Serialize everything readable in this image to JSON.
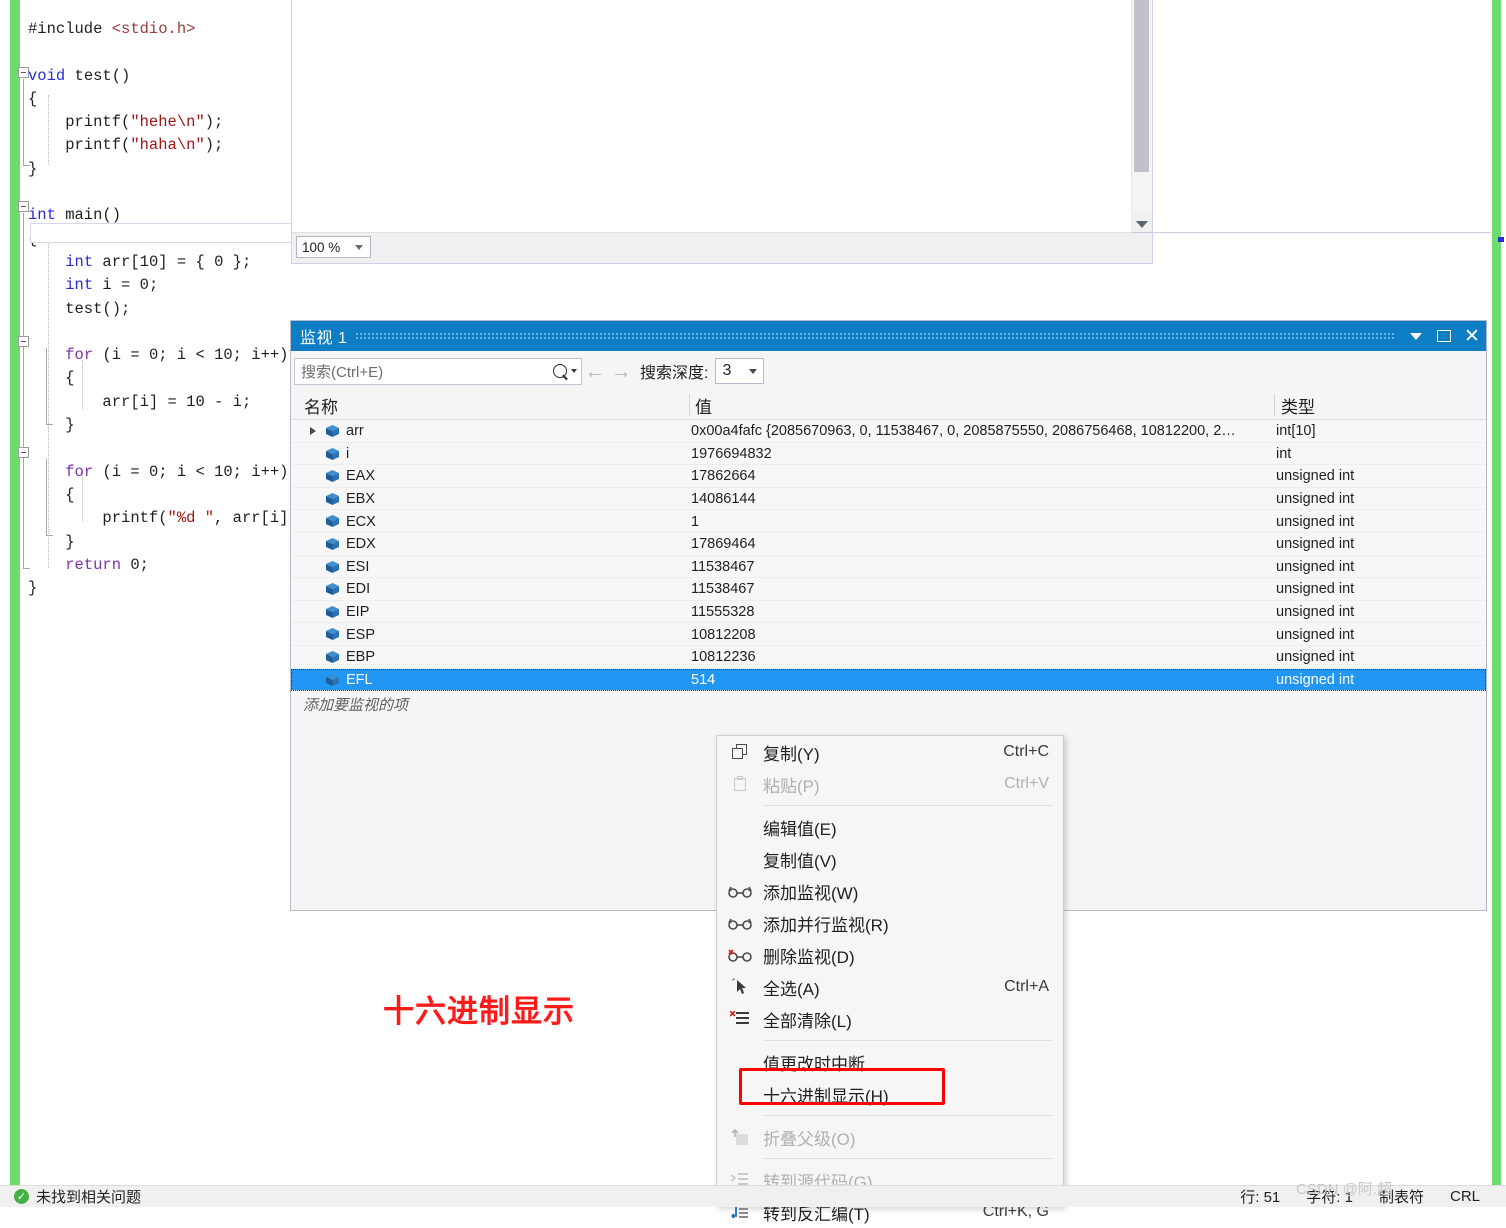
{
  "editor": {
    "zoom_value": "100 %",
    "code_lines": [
      [
        {
          "t": "#include ",
          "c": "plain"
        },
        {
          "t": "<stdio.h>",
          "c": "pre"
        }
      ],
      [],
      [
        {
          "t": "void",
          "c": "kw"
        },
        {
          "t": " test()",
          "c": "plain"
        }
      ],
      [
        {
          "t": "{",
          "c": "plain"
        }
      ],
      [
        {
          "t": "    printf(",
          "c": "plain"
        },
        {
          "t": "\"hehe\\n\"",
          "c": "str"
        },
        {
          "t": ");",
          "c": "plain"
        }
      ],
      [
        {
          "t": "    printf(",
          "c": "plain"
        },
        {
          "t": "\"haha\\n\"",
          "c": "str"
        },
        {
          "t": ");",
          "c": "plain"
        }
      ],
      [
        {
          "t": "}",
          "c": "plain"
        }
      ],
      [],
      [
        {
          "t": "int",
          "c": "kw"
        },
        {
          "t": " main()",
          "c": "plain"
        }
      ],
      [
        {
          "t": "{",
          "c": "plain"
        }
      ],
      [
        {
          "t": "    ",
          "c": "plain"
        },
        {
          "t": "int",
          "c": "kw"
        },
        {
          "t": " arr[",
          "c": "plain"
        },
        {
          "t": "10",
          "c": "num"
        },
        {
          "t": "] = { ",
          "c": "plain"
        },
        {
          "t": "0",
          "c": "num"
        },
        {
          "t": " };",
          "c": "plain"
        }
      ],
      [
        {
          "t": "    ",
          "c": "plain"
        },
        {
          "t": "int",
          "c": "kw"
        },
        {
          "t": " i = ",
          "c": "plain"
        },
        {
          "t": "0",
          "c": "num"
        },
        {
          "t": ";",
          "c": "plain"
        }
      ],
      [
        {
          "t": "    test();",
          "c": "plain"
        }
      ],
      [],
      [
        {
          "t": "    ",
          "c": "plain"
        },
        {
          "t": "for",
          "c": "ctl"
        },
        {
          "t": " (i = ",
          "c": "plain"
        },
        {
          "t": "0",
          "c": "num"
        },
        {
          "t": "; i < ",
          "c": "plain"
        },
        {
          "t": "10",
          "c": "num"
        },
        {
          "t": "; i++)",
          "c": "plain"
        }
      ],
      [
        {
          "t": "    {",
          "c": "plain"
        }
      ],
      [
        {
          "t": "        arr[i] = ",
          "c": "plain"
        },
        {
          "t": "10",
          "c": "num"
        },
        {
          "t": " - i;",
          "c": "plain"
        }
      ],
      [
        {
          "t": "    }",
          "c": "plain"
        }
      ],
      [],
      [
        {
          "t": "    ",
          "c": "plain"
        },
        {
          "t": "for",
          "c": "ctl"
        },
        {
          "t": " (i = ",
          "c": "plain"
        },
        {
          "t": "0",
          "c": "num"
        },
        {
          "t": "; i < ",
          "c": "plain"
        },
        {
          "t": "10",
          "c": "num"
        },
        {
          "t": "; i++)",
          "c": "plain"
        }
      ],
      [
        {
          "t": "    {",
          "c": "plain"
        }
      ],
      [
        {
          "t": "        printf(",
          "c": "plain"
        },
        {
          "t": "\"%d \"",
          "c": "str"
        },
        {
          "t": ", arr[i]);",
          "c": "plain"
        }
      ],
      [
        {
          "t": "    }",
          "c": "plain"
        }
      ],
      [
        {
          "t": "    ",
          "c": "plain"
        },
        {
          "t": "return",
          "c": "ctl"
        },
        {
          "t": " ",
          "c": "plain"
        },
        {
          "t": "0",
          "c": "num"
        },
        {
          "t": ";",
          "c": "plain"
        }
      ],
      [
        {
          "t": "}",
          "c": "plain"
        }
      ]
    ]
  },
  "watch": {
    "title": "监视 1",
    "search_placeholder": "搜索(Ctrl+E)",
    "depth_label": "搜索深度:",
    "depth_value": "3",
    "columns": [
      "名称",
      "值",
      "类型"
    ],
    "rows": [
      {
        "name": "arr",
        "value": "0x00a4fafc {2085670963, 0, 11538467, 0, 2085875550, 2086756468, 10812200, 2…",
        "type": "int[10]",
        "expandable": true,
        "selected": false
      },
      {
        "name": "i",
        "value": "1976694832",
        "type": "int",
        "expandable": false,
        "selected": false
      },
      {
        "name": "EAX",
        "value": "17862664",
        "type": "unsigned int",
        "expandable": false,
        "selected": false
      },
      {
        "name": "EBX",
        "value": "14086144",
        "type": "unsigned int",
        "expandable": false,
        "selected": false
      },
      {
        "name": "ECX",
        "value": "1",
        "type": "unsigned int",
        "expandable": false,
        "selected": false
      },
      {
        "name": "EDX",
        "value": "17869464",
        "type": "unsigned int",
        "expandable": false,
        "selected": false
      },
      {
        "name": "ESI",
        "value": "11538467",
        "type": "unsigned int",
        "expandable": false,
        "selected": false
      },
      {
        "name": "EDI",
        "value": "11538467",
        "type": "unsigned int",
        "expandable": false,
        "selected": false
      },
      {
        "name": "EIP",
        "value": "11555328",
        "type": "unsigned int",
        "expandable": false,
        "selected": false
      },
      {
        "name": "ESP",
        "value": "10812208",
        "type": "unsigned int",
        "expandable": false,
        "selected": false
      },
      {
        "name": "EBP",
        "value": "10812236",
        "type": "unsigned int",
        "expandable": false,
        "selected": false
      },
      {
        "name": "EFL",
        "value": "514",
        "type": "unsigned int",
        "expandable": false,
        "selected": true
      }
    ],
    "add_item_hint": "添加要监视的项"
  },
  "annotation": {
    "red_text": "十六进制显示"
  },
  "context_menu": {
    "items": [
      {
        "label": "复制(Y)",
        "shortcut": "Ctrl+C",
        "icon": "copy-icon",
        "disabled": false
      },
      {
        "label": "粘贴(P)",
        "shortcut": "Ctrl+V",
        "icon": "paste-icon",
        "disabled": true
      },
      {
        "separator": true
      },
      {
        "label": "编辑值(E)",
        "shortcut": "",
        "icon": "",
        "disabled": false
      },
      {
        "label": "复制值(V)",
        "shortcut": "",
        "icon": "",
        "disabled": false
      },
      {
        "label": "添加监视(W)",
        "shortcut": "",
        "icon": "glasses-icon",
        "disabled": false
      },
      {
        "label": "添加并行监视(R)",
        "shortcut": "",
        "icon": "glasses-icon",
        "disabled": false
      },
      {
        "label": "删除监视(D)",
        "shortcut": "",
        "icon": "glasses-delete-icon",
        "disabled": false
      },
      {
        "label": "全选(A)",
        "shortcut": "Ctrl+A",
        "icon": "cursor-select-icon",
        "disabled": false
      },
      {
        "label": "全部清除(L)",
        "shortcut": "",
        "icon": "clear-all-icon",
        "disabled": false
      },
      {
        "separator": true
      },
      {
        "label": "值更改时中断",
        "shortcut": "",
        "icon": "",
        "disabled": false
      },
      {
        "label": "十六进制显示(H)",
        "shortcut": "",
        "icon": "",
        "disabled": false,
        "highlighted": true
      },
      {
        "separator": true
      },
      {
        "label": "折叠父级(O)",
        "shortcut": "",
        "icon": "collapse-parent-icon",
        "disabled": true
      },
      {
        "separator": true
      },
      {
        "label": "转到源代码(G)",
        "shortcut": "",
        "icon": "goto-source-icon",
        "disabled": true
      },
      {
        "label": "转到反汇编(T)",
        "shortcut": "Ctrl+K, G",
        "icon": "goto-disassembly-icon",
        "disabled": false
      }
    ]
  },
  "statusbar": {
    "ok_text": "未找到相关问题",
    "line": "行: 51",
    "char": "字符: 1",
    "tab": "制表符",
    "eol": "CRL"
  },
  "watermark": "CSDN @阿.超",
  "colors": {
    "accent_blue": "#0d7ec4",
    "selection_blue": "#2196f3",
    "change_green": "#6fdb6f",
    "annotation_red": "#ff1a1a"
  }
}
